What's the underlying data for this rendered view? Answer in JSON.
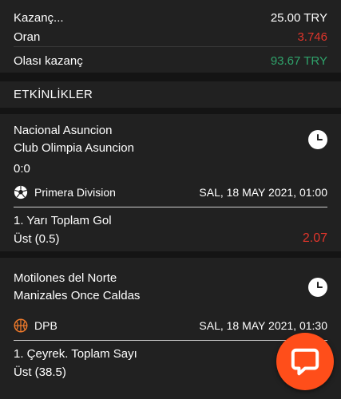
{
  "summary": {
    "stake_label": "Kazanç...",
    "stake_value": "25.00 TRY",
    "odds_label": "Oran",
    "odds_value": "3.746",
    "potential_label": "Olası kazanç",
    "potential_value": "93.67 TRY"
  },
  "section": {
    "title": "ETKİNLİKLER"
  },
  "events": [
    {
      "home": "Nacional Asuncion",
      "away": "Club Olimpia Asuncion",
      "score": "0:0",
      "sport_icon": "soccer-ball-icon",
      "league": "Primera Division",
      "datetime": "SAL, 18 MAY 2021, 01:00",
      "market": "1. Yarı Toplam Gol",
      "selection": "Üst (0.5)",
      "odd": "2.07"
    },
    {
      "home": "Motilones del Norte",
      "away": "Manizales Once Caldas",
      "sport_icon": "basketball-icon",
      "league": "DPB",
      "datetime": "SAL, 18 MAY 2021, 01:30",
      "market": "1. Çeyrek. Toplam Sayı",
      "selection": "Üst (38.5)"
    }
  ],
  "colors": {
    "accent": "#ff4e1a",
    "odds_red": "#e0352b",
    "win_green": "#2fa36b",
    "panel": "#212121",
    "background": "#141414"
  }
}
